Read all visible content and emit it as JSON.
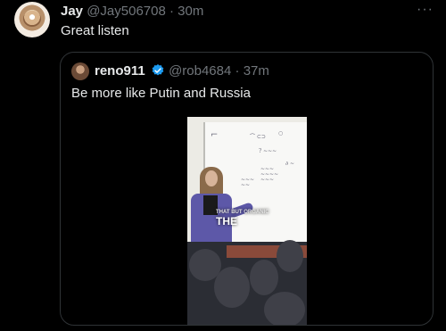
{
  "tweet": {
    "author_name": "Jay",
    "handle": "@Jay506708",
    "time": "30m",
    "separator": "·",
    "more": "···",
    "text": "Great listen"
  },
  "quoted": {
    "author_name": "reno911",
    "handle": "@rob4684",
    "time": "37m",
    "separator": "·",
    "text": "Be more like Putin and Russia",
    "video_caption_small": "THAT BUT ORGANIC",
    "video_caption_big": "THE"
  },
  "colors": {
    "background": "#000000",
    "text": "#e7e9ea",
    "muted": "#71767b",
    "verified": "#1d9bf0",
    "border": "#2f3336"
  }
}
